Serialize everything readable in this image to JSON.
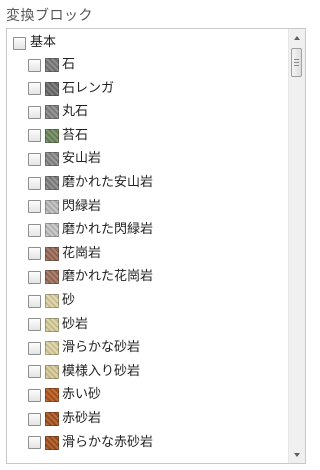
{
  "title": "変換ブロック",
  "tree": {
    "root": {
      "label": "基本",
      "checked": false
    },
    "items": [
      {
        "label": "石",
        "swatch_color": "#7d7d7d",
        "icon": "stone-block-icon",
        "checked": false
      },
      {
        "label": "石レンガ",
        "swatch_color": "#6e6e6e",
        "icon": "stone-brick-block-icon",
        "checked": false
      },
      {
        "label": "丸石",
        "swatch_color": "#888888",
        "icon": "cobblestone-block-icon",
        "checked": false
      },
      {
        "label": "苔石",
        "swatch_color": "#6f8a5e",
        "icon": "mossy-stone-block-icon",
        "checked": false
      },
      {
        "label": "安山岩",
        "swatch_color": "#8a8a8a",
        "icon": "andesite-block-icon",
        "checked": false
      },
      {
        "label": "磨かれた安山岩",
        "swatch_color": "#858585",
        "icon": "polished-andesite-block-icon",
        "checked": false
      },
      {
        "label": "閃緑岩",
        "swatch_color": "#bdbdbd",
        "icon": "diorite-block-icon",
        "checked": false
      },
      {
        "label": "磨かれた閃緑岩",
        "swatch_color": "#c4c4c4",
        "icon": "polished-diorite-block-icon",
        "checked": false
      },
      {
        "label": "花崗岩",
        "swatch_color": "#9a6b57",
        "icon": "granite-block-icon",
        "checked": false
      },
      {
        "label": "磨かれた花崗岩",
        "swatch_color": "#a06f5b",
        "icon": "polished-granite-block-icon",
        "checked": false
      },
      {
        "label": "砂",
        "swatch_color": "#ddd3a4",
        "icon": "sand-block-icon",
        "checked": false
      },
      {
        "label": "砂岩",
        "swatch_color": "#d9cf9c",
        "icon": "sandstone-block-icon",
        "checked": false
      },
      {
        "label": "滑らかな砂岩",
        "swatch_color": "#dcd2a0",
        "icon": "smooth-sandstone-block-icon",
        "checked": false
      },
      {
        "label": "模様入り砂岩",
        "swatch_color": "#d6cb97",
        "icon": "chiseled-sandstone-block-icon",
        "checked": false
      },
      {
        "label": "赤い砂",
        "swatch_color": "#b5591d",
        "icon": "red-sand-block-icon",
        "checked": false
      },
      {
        "label": "赤砂岩",
        "swatch_color": "#aa5520",
        "icon": "red-sandstone-block-icon",
        "checked": false
      },
      {
        "label": "滑らかな赤砂岩",
        "swatch_color": "#a8531e",
        "icon": "smooth-red-sandstone-block-icon",
        "checked": false
      }
    ]
  },
  "scrollbar": {
    "up_icon": "scroll-up-arrow-icon",
    "down_icon": "scroll-down-arrow-icon"
  }
}
